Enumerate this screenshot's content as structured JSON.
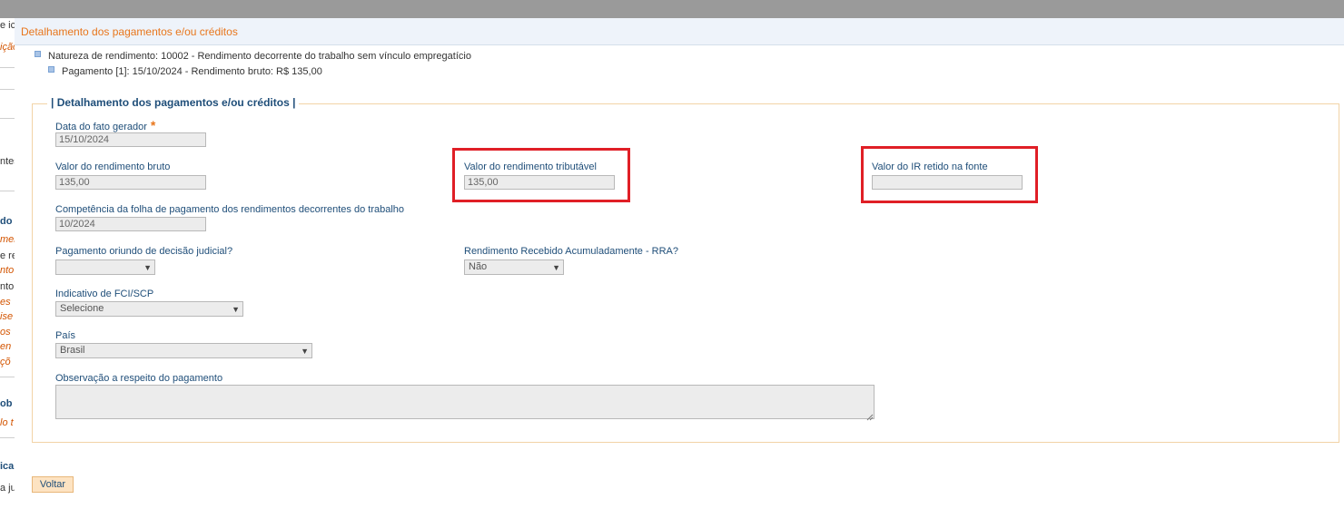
{
  "background_page": {
    "fragments": [
      {
        "text": "e ic",
        "style": "dark"
      },
      {
        "text": "ição",
        "style": "orange"
      },
      {
        "text": "ntes",
        "style": "dark"
      },
      {
        "text": "do",
        "style": "blue"
      },
      {
        "text": "mer",
        "style": "orange"
      },
      {
        "text": "e re",
        "style": "dark"
      },
      {
        "text": "nto",
        "style": "orange"
      },
      {
        "text": "nto",
        "style": "dark"
      },
      {
        "text": "es",
        "style": "orange"
      },
      {
        "text": "ise",
        "style": "orange"
      },
      {
        "text": "os",
        "style": "orange"
      },
      {
        "text": "en",
        "style": "orange"
      },
      {
        "text": "çõ",
        "style": "orange"
      },
      {
        "text": "ob",
        "style": "blue"
      },
      {
        "text": "lo t",
        "style": "orange"
      },
      {
        "text": "ica",
        "style": "blue"
      },
      {
        "text": "a ju",
        "style": "dark"
      }
    ]
  },
  "modal": {
    "title": "Detalhamento dos pagamentos e/ou créditos",
    "tree": {
      "nature": "Natureza de rendimento: 10002 - Rendimento decorrente do trabalho sem vínculo empregatício",
      "payment": "Pagamento [1]: 15/10/2024 - Rendimento bruto: R$ 135,00"
    },
    "fieldset_legend": "| Detalhamento dos pagamentos e/ou créditos |",
    "fields": {
      "fato_gerador": {
        "label": "Data do fato gerador",
        "required_mark": "*",
        "value": "15/10/2024"
      },
      "rendimento_bruto": {
        "label": "Valor do rendimento bruto",
        "value": "135,00"
      },
      "rendimento_tributavel": {
        "label": "Valor do rendimento tributável",
        "value": "135,00"
      },
      "ir_retido": {
        "label": "Valor do IR retido na fonte",
        "value": ""
      },
      "competencia": {
        "label": "Competência da folha de pagamento dos rendimentos decorrentes do trabalho",
        "value": "10/2024"
      },
      "decisao_judicial": {
        "label": "Pagamento oriundo de decisão judicial?",
        "value": ""
      },
      "rra": {
        "label": "Rendimento Recebido Acumuladamente - RRA?",
        "value": "Não"
      },
      "fci_scp": {
        "label": "Indicativo de FCI/SCP",
        "value": "Selecione"
      },
      "pais": {
        "label": "País",
        "value": "Brasil"
      },
      "observacao": {
        "label": "Observação a respeito do pagamento",
        "value": ""
      }
    },
    "back_button": "Voltar",
    "highlight_color": "#e01f26",
    "accent_color": "#e8761c",
    "label_color": "#1f4e79"
  }
}
